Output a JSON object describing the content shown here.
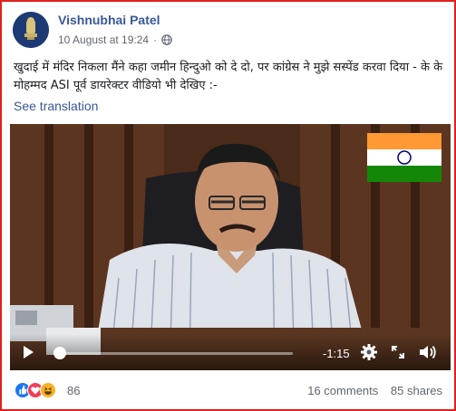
{
  "post": {
    "author": "Vishnubhai Patel",
    "date": "10 August at 19:24",
    "separator": "·",
    "more": "···",
    "text": "खुदाई में मंदिर निकला मैंने कहा जमीन हिन्दुओ को दे दो, पर कांग्रेस ने मुझे सस्पेंड करवा दिया - के के मोहम्मद ASI पूर्व डायरेक्टर वीडियो भी देखिए :-",
    "see_translation": "See translation"
  },
  "video": {
    "time_remaining": "-1:15",
    "progress": 0.02
  },
  "footer": {
    "reaction_count": "86",
    "comments": "16 comments",
    "shares": "85 shares"
  },
  "icons": [
    "globe-icon",
    "play-icon",
    "settings-icon",
    "fullscreen-icon",
    "volume-icon",
    "like-icon",
    "love-icon",
    "haha-icon"
  ],
  "colors": {
    "link": "#385898",
    "border": "#e0201d",
    "like": "#1877f2",
    "love": "#f33e58",
    "haha": "#f7b125"
  }
}
